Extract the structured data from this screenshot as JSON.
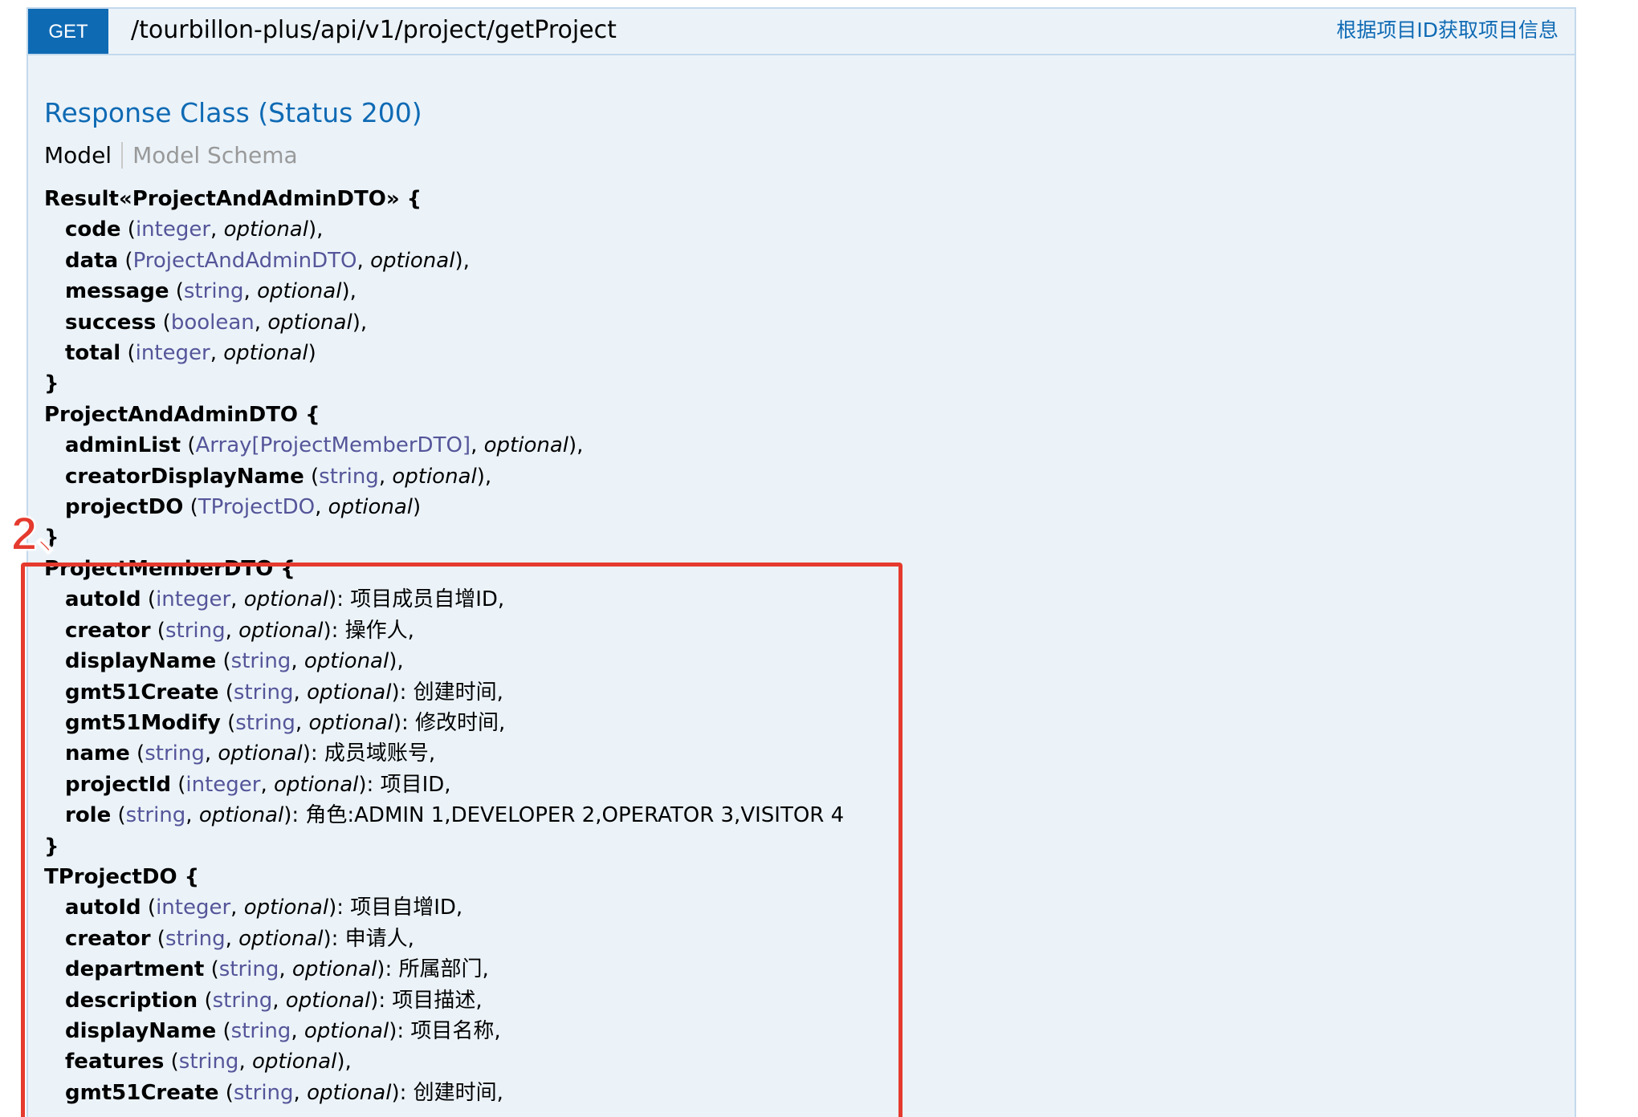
{
  "endpoint": {
    "method": "GET",
    "path": "/tourbillon-plus/api/v1/project/getProject",
    "summary": "根据项目ID获取项目信息"
  },
  "response": {
    "title": "Response Class (Status 200)",
    "tabs": {
      "model": "Model",
      "schema": "Model Schema"
    }
  },
  "models": [
    {
      "name": "Result«ProjectAndAdminDTO» {",
      "close": "}",
      "props": [
        {
          "name": "code",
          "type": "integer",
          "opt": "optional",
          "tail": "),",
          "desc": ""
        },
        {
          "name": "data",
          "type": "ProjectAndAdminDTO",
          "opt": "optional",
          "tail": "),",
          "desc": ""
        },
        {
          "name": "message",
          "type": "string",
          "opt": "optional",
          "tail": "),",
          "desc": ""
        },
        {
          "name": "success",
          "type": "boolean",
          "opt": "optional",
          "tail": "),",
          "desc": ""
        },
        {
          "name": "total",
          "type": "integer",
          "opt": "optional",
          "tail": ")",
          "desc": ""
        }
      ]
    },
    {
      "name": "ProjectAndAdminDTO {",
      "close": "}",
      "props": [
        {
          "name": "adminList",
          "type": "Array[ProjectMemberDTO]",
          "opt": "optional",
          "tail": "),",
          "desc": ""
        },
        {
          "name": "creatorDisplayName",
          "type": "string",
          "opt": "optional",
          "tail": "),",
          "desc": ""
        },
        {
          "name": "projectDO",
          "type": "TProjectDO",
          "opt": "optional",
          "tail": ")",
          "desc": ""
        }
      ]
    },
    {
      "name": "ProjectMemberDTO {",
      "close": "}",
      "props": [
        {
          "name": "autoId",
          "type": "integer",
          "opt": "optional",
          "tail": "):",
          "desc": "项目成员自增ID,"
        },
        {
          "name": "creator",
          "type": "string",
          "opt": "optional",
          "tail": "):",
          "desc": "操作人,"
        },
        {
          "name": "displayName",
          "type": "string",
          "opt": "optional",
          "tail": "),",
          "desc": ""
        },
        {
          "name": "gmt51Create",
          "type": "string",
          "opt": "optional",
          "tail": "):",
          "desc": "创建时间,"
        },
        {
          "name": "gmt51Modify",
          "type": "string",
          "opt": "optional",
          "tail": "):",
          "desc": "修改时间,"
        },
        {
          "name": "name",
          "type": "string",
          "opt": "optional",
          "tail": "):",
          "desc": "成员域账号,"
        },
        {
          "name": "projectId",
          "type": "integer",
          "opt": "optional",
          "tail": "):",
          "desc": "项目ID,"
        },
        {
          "name": "role",
          "type": "string",
          "opt": "optional",
          "tail": "):",
          "desc": "角色:ADMIN 1,DEVELOPER 2,OPERATOR 3,VISITOR 4"
        }
      ]
    },
    {
      "name": "TProjectDO {",
      "close": "",
      "props": [
        {
          "name": "autoId",
          "type": "integer",
          "opt": "optional",
          "tail": "):",
          "desc": "项目自增ID,"
        },
        {
          "name": "creator",
          "type": "string",
          "opt": "optional",
          "tail": "):",
          "desc": "申请人,"
        },
        {
          "name": "department",
          "type": "string",
          "opt": "optional",
          "tail": "):",
          "desc": "所属部门,"
        },
        {
          "name": "description",
          "type": "string",
          "opt": "optional",
          "tail": "):",
          "desc": "项目描述,"
        },
        {
          "name": "displayName",
          "type": "string",
          "opt": "optional",
          "tail": "):",
          "desc": "项目名称,"
        },
        {
          "name": "features",
          "type": "string",
          "opt": "optional",
          "tail": "),",
          "desc": ""
        },
        {
          "name": "gmt51Create",
          "type": "string",
          "opt": "optional",
          "tail": "):",
          "desc": "创建时间,"
        }
      ]
    }
  ],
  "annotation": {
    "label": "2、",
    "color": "#e53a2e"
  },
  "colors": {
    "method_bg": "#0f6ab4",
    "link": "#0f6ab4",
    "type": "#555599",
    "panel_bg": "#ebf3f9",
    "panel_border": "#c3d9ec"
  }
}
